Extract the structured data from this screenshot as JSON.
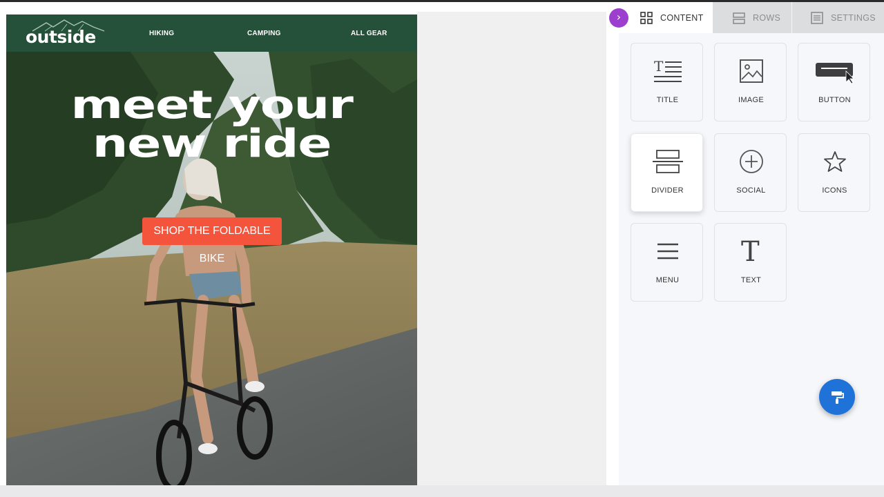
{
  "email": {
    "logo_text": "outside",
    "nav": [
      "HIKING",
      "CAMPING",
      "ALL GEAR"
    ],
    "hero_title_line1": "meet your",
    "hero_title_line2": "new ride",
    "cta_label": "SHOP THE FOLDABLE BIKE",
    "colors": {
      "header": "#25513a",
      "cta": "#f4543c"
    }
  },
  "panel": {
    "tabs": [
      {
        "label": "CONTENT",
        "icon": "grid-icon",
        "active": true
      },
      {
        "label": "ROWS",
        "icon": "rows-icon",
        "active": false
      },
      {
        "label": "SETTINGS",
        "icon": "settings-doc-icon",
        "active": false
      }
    ],
    "tiles": [
      {
        "label": "TITLE",
        "icon": "title-icon"
      },
      {
        "label": "IMAGE",
        "icon": "image-icon"
      },
      {
        "label": "BUTTON",
        "icon": "button-icon"
      },
      {
        "label": "DIVIDER",
        "icon": "divider-icon"
      },
      {
        "label": "SOCIAL",
        "icon": "plus-circle-icon"
      },
      {
        "label": "ICONS",
        "icon": "star-icon"
      },
      {
        "label": "MENU",
        "icon": "menu-icon"
      },
      {
        "label": "TEXT",
        "icon": "text-icon"
      }
    ],
    "colors": {
      "collapse": "#9c3fcf",
      "fab": "#1f72d8"
    }
  }
}
